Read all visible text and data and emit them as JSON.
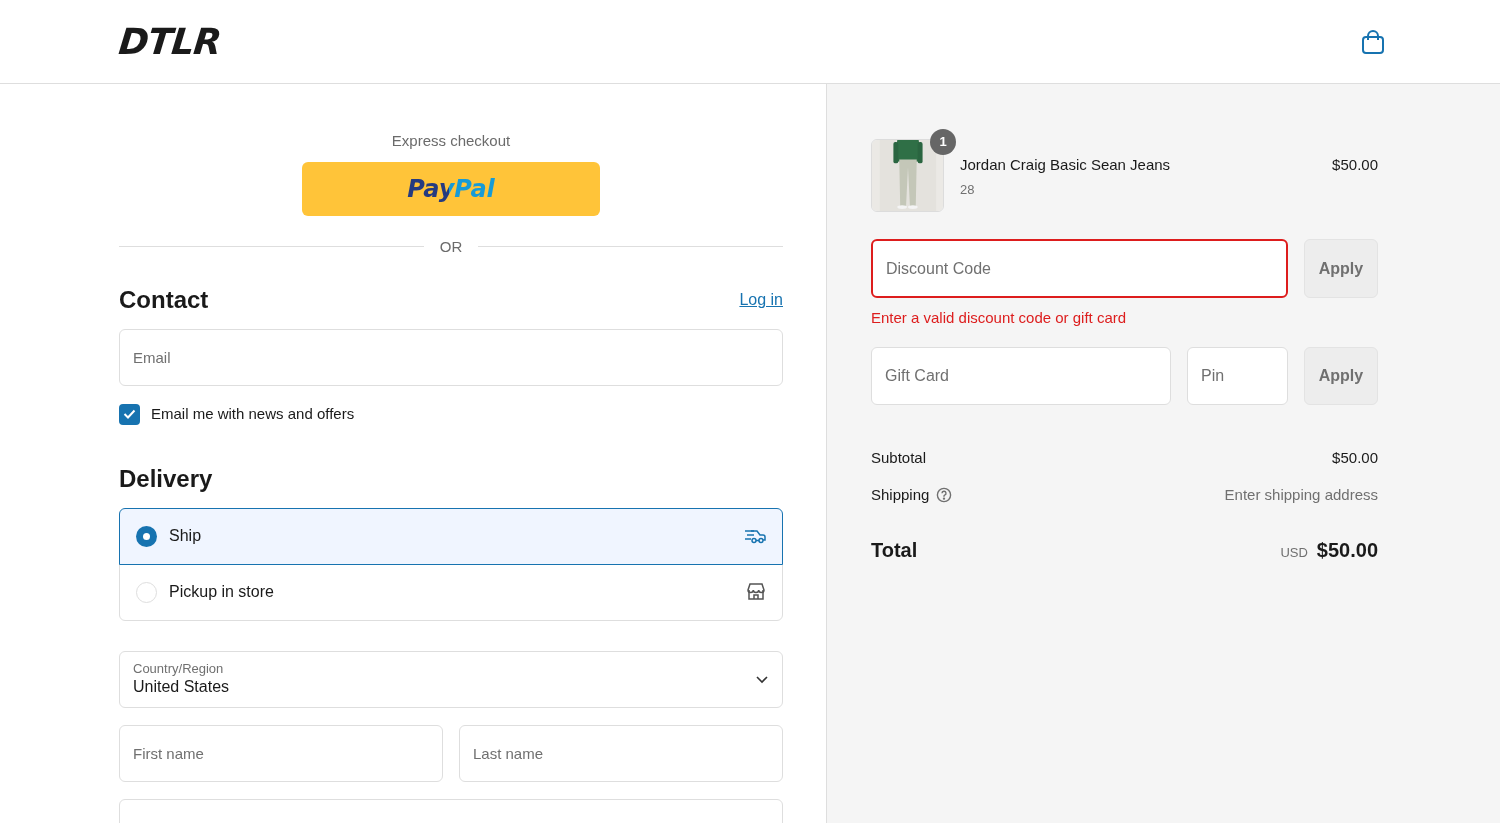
{
  "header": {
    "logo": "DTLR"
  },
  "express_checkout": {
    "label": "Express checkout",
    "paypal": "PayPal",
    "divider": "OR"
  },
  "contact": {
    "heading": "Contact",
    "login_link": "Log in",
    "email": {
      "placeholder": "Email"
    },
    "newsletter": {
      "label": "Email me with news and offers",
      "checked": true
    }
  },
  "delivery": {
    "heading": "Delivery",
    "options": [
      {
        "label": "Ship",
        "kind": "ship",
        "selected": true
      },
      {
        "label": "Pickup in store",
        "kind": "pickup",
        "selected": false
      }
    ]
  },
  "address": {
    "country": {
      "label": "Country/Region",
      "value": "United States"
    },
    "first_name": {
      "placeholder": "First name"
    },
    "last_name": {
      "placeholder": "Last name"
    }
  },
  "order_summary": {
    "items": [
      {
        "name": "Jordan Craig Basic Sean Jeans",
        "variant": "28",
        "quantity": "1",
        "price": "$50.00"
      }
    ],
    "discount": {
      "placeholder": "Discount Code",
      "button": "Apply",
      "invalid": true,
      "error": "Enter a valid discount code or gift card"
    },
    "gift_card": {
      "placeholder": "Gift Card",
      "pin_placeholder": "Pin",
      "button": "Apply"
    },
    "subtotal": {
      "label": "Subtotal",
      "value": "$50.00"
    },
    "shipping": {
      "label": "Shipping",
      "value": "Enter shipping address"
    },
    "total": {
      "label": "Total",
      "currency": "USD",
      "value": "$50.00"
    }
  }
}
